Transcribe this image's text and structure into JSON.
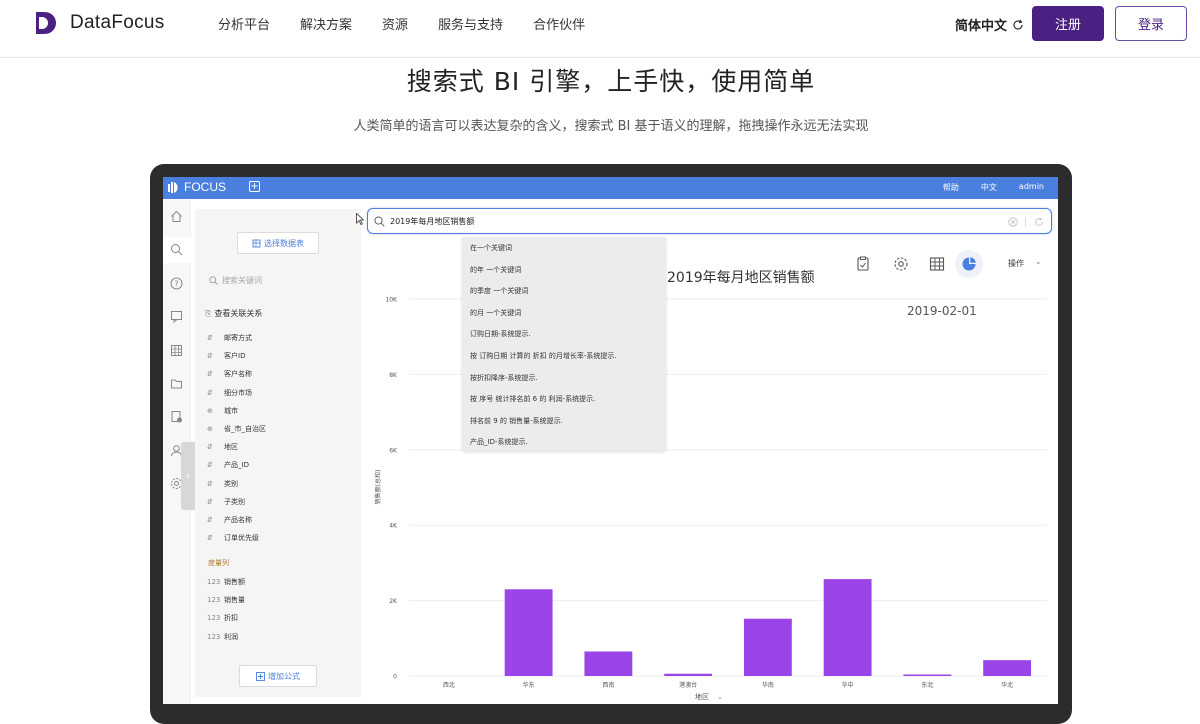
{
  "nav": {
    "brand": "DataFocus",
    "links": [
      "分析平台",
      "解决方案",
      "资源",
      "服务与支持",
      "合作伙伴"
    ],
    "language": "简体中文",
    "register": "注册",
    "login": "登录",
    "brand_color": "#4a2183"
  },
  "hero": {
    "title": "搜索式 BI 引擎，上手快，使用简单",
    "subtitle": "人类简单的语言可以表达复杂的含义，搜索式 BI 基于语义的理解，拖拽操作永远无法实现"
  },
  "app": {
    "logo": "FOCUS",
    "header_links": [
      "帮助",
      "中文",
      "admin"
    ],
    "header_color": "#4a7fe0",
    "rail_icons": [
      "home-icon",
      "search-icon",
      "help-icon",
      "chat-icon",
      "table-icon",
      "folder-icon",
      "report-icon",
      "user-icon",
      "settings-icon"
    ],
    "select_datasource": "选择数据表",
    "field_search_placeholder": "搜索关键词",
    "view_relations": "查看关联关系",
    "dimension_fields": [
      {
        "type": "⇵",
        "name": "邮寄方式"
      },
      {
        "type": "⇵",
        "name": "客户ID"
      },
      {
        "type": "⇵",
        "name": "客户名称"
      },
      {
        "type": "⇵",
        "name": "细分市场"
      },
      {
        "type": "⊕",
        "name": "城市"
      },
      {
        "type": "⊕",
        "name": "省_市_自治区"
      },
      {
        "type": "⇵",
        "name": "地区"
      },
      {
        "type": "⇵",
        "name": "产品_ID"
      },
      {
        "type": "⇵",
        "name": "类别"
      },
      {
        "type": "⇵",
        "name": "子类别"
      },
      {
        "type": "⇵",
        "name": "产品名称"
      },
      {
        "type": "⇵",
        "name": "订单优先级"
      }
    ],
    "measure_label": "度量列",
    "measure_fields": [
      {
        "type": "123",
        "name": "销售额"
      },
      {
        "type": "123",
        "name": "销售量"
      },
      {
        "type": "123",
        "name": "折扣"
      },
      {
        "type": "123",
        "name": "利润"
      }
    ],
    "add_formula": "增加公式",
    "search_value": "2019年每月地区销售额",
    "suggestions": [
      "在一个关键词",
      "的年 一个关键词",
      "的季度 一个关键词",
      "的月 一个关键词",
      "订购日期-系统提示.",
      "按 订购日期 计算的 折扣 的月增长率-系统提示.",
      "按折扣降序-系统提示.",
      "按 序号 统计排名前 6 的 利润-系统提示.",
      "排名前 9 的 销售量-系统提示.",
      "产品_ID-系统提示."
    ],
    "operations": "操作"
  },
  "chart_data": {
    "type": "bar",
    "title": "2019年每月地区销售额",
    "date_label": "2019-02-01",
    "ylabel": "销售额(总和)",
    "xlabel": "地区",
    "categories": [
      "西北",
      "华东",
      "西南",
      "港澳台",
      "华南",
      "华中",
      "东北",
      "华北"
    ],
    "values": [
      0,
      2300,
      650,
      60,
      1520,
      2570,
      20,
      420
    ],
    "ylim": [
      0,
      10000
    ],
    "yticks": [
      "0",
      "2K",
      "4K",
      "6K",
      "8K",
      "10K"
    ],
    "grid": true,
    "bar_color": "#9b45e8"
  }
}
